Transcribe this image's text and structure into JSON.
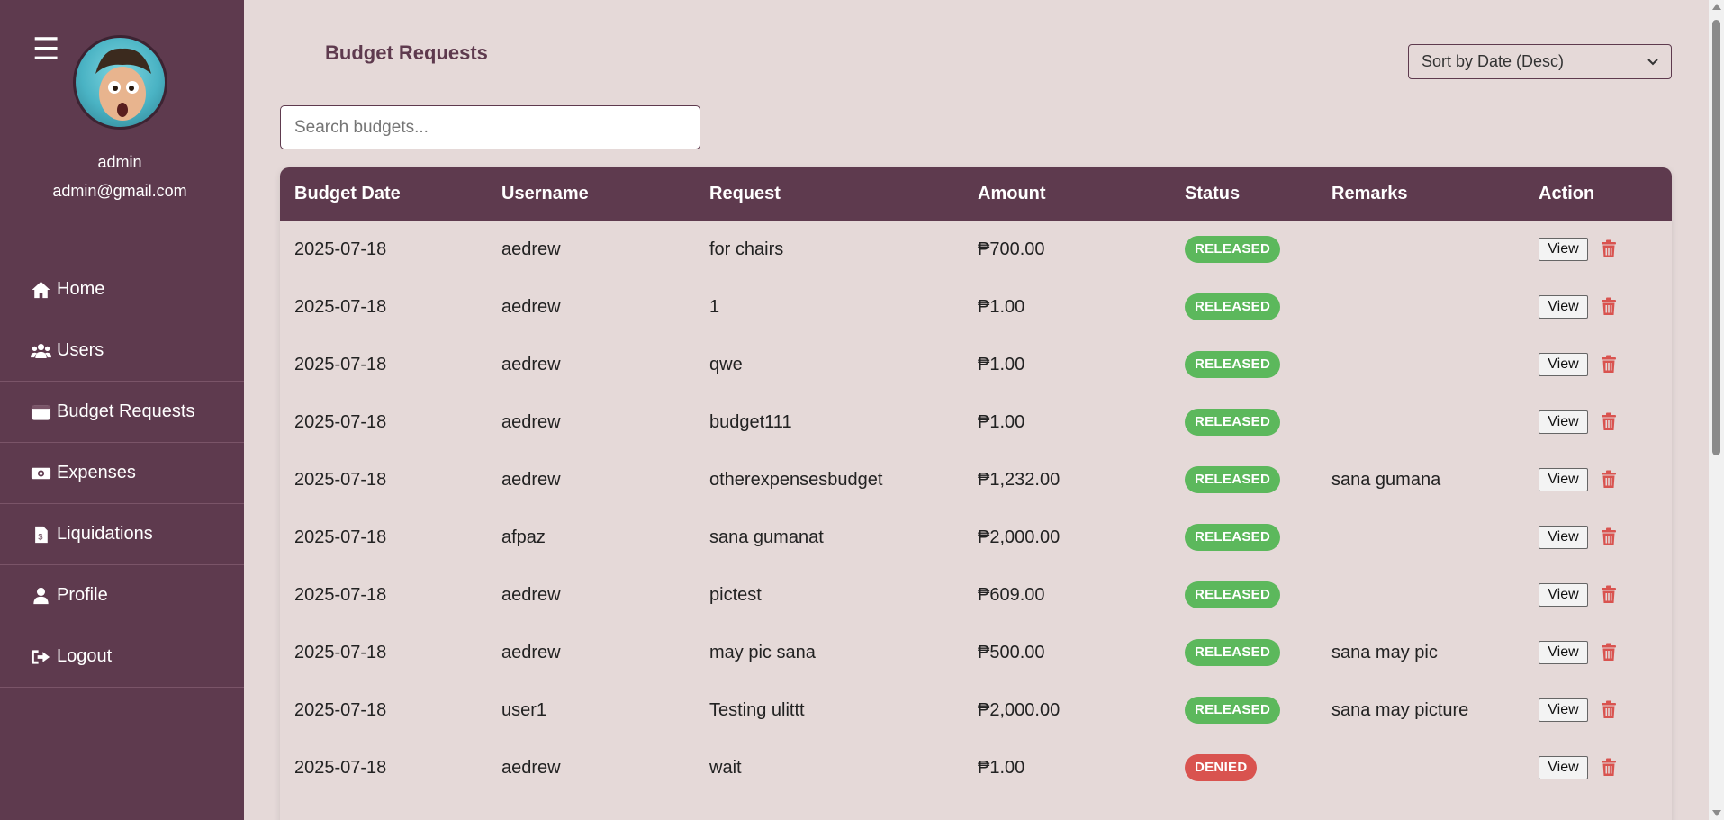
{
  "sidebar": {
    "user": {
      "name": "admin",
      "email": "admin@gmail.com"
    },
    "menu_icon": "hamburger-icon",
    "items": [
      {
        "label": "Home",
        "icon": "home-icon"
      },
      {
        "label": "Users",
        "icon": "users-icon"
      },
      {
        "label": "Budget Requests",
        "icon": "wallet-icon"
      },
      {
        "label": "Expenses",
        "icon": "money-bill-icon"
      },
      {
        "label": "Liquidations",
        "icon": "receipt-icon"
      },
      {
        "label": "Profile",
        "icon": "user-icon"
      },
      {
        "label": "Logout",
        "icon": "logout-icon"
      }
    ]
  },
  "main": {
    "title": "Budget Requests",
    "sort": {
      "selected": "Sort by Date (Desc)"
    },
    "search": {
      "placeholder": "Search budgets...",
      "value": ""
    },
    "table": {
      "headers": [
        "Budget Date",
        "Username",
        "Request",
        "Amount",
        "Status",
        "Remarks",
        "Action"
      ],
      "view_label": "View",
      "rows": [
        {
          "date": "2025-07-18",
          "username": "aedrew",
          "request": "for chairs",
          "amount": "₱700.00",
          "status": "RELEASED",
          "remarks": ""
        },
        {
          "date": "2025-07-18",
          "username": "aedrew",
          "request": "1",
          "amount": "₱1.00",
          "status": "RELEASED",
          "remarks": ""
        },
        {
          "date": "2025-07-18",
          "username": "aedrew",
          "request": "qwe",
          "amount": "₱1.00",
          "status": "RELEASED",
          "remarks": ""
        },
        {
          "date": "2025-07-18",
          "username": "aedrew",
          "request": "budget111",
          "amount": "₱1.00",
          "status": "RELEASED",
          "remarks": ""
        },
        {
          "date": "2025-07-18",
          "username": "aedrew",
          "request": "otherexpensesbudget",
          "amount": "₱1,232.00",
          "status": "RELEASED",
          "remarks": "sana gumana"
        },
        {
          "date": "2025-07-18",
          "username": "afpaz",
          "request": "sana gumanat",
          "amount": "₱2,000.00",
          "status": "RELEASED",
          "remarks": ""
        },
        {
          "date": "2025-07-18",
          "username": "aedrew",
          "request": "pictest",
          "amount": "₱609.00",
          "status": "RELEASED",
          "remarks": ""
        },
        {
          "date": "2025-07-18",
          "username": "aedrew",
          "request": "may pic sana",
          "amount": "₱500.00",
          "status": "RELEASED",
          "remarks": "sana may pic"
        },
        {
          "date": "2025-07-18",
          "username": "user1",
          "request": "Testing ulittt",
          "amount": "₱2,000.00",
          "status": "RELEASED",
          "remarks": "sana may picture"
        },
        {
          "date": "2025-07-18",
          "username": "aedrew",
          "request": "wait",
          "amount": "₱1.00",
          "status": "DENIED",
          "remarks": ""
        }
      ]
    }
  },
  "colors": {
    "sidebar_bg": "#5e3a4e",
    "page_bg": "#e5d9d8",
    "released": "#5cb85c",
    "denied": "#d9534f",
    "trash": "#d9534f"
  }
}
